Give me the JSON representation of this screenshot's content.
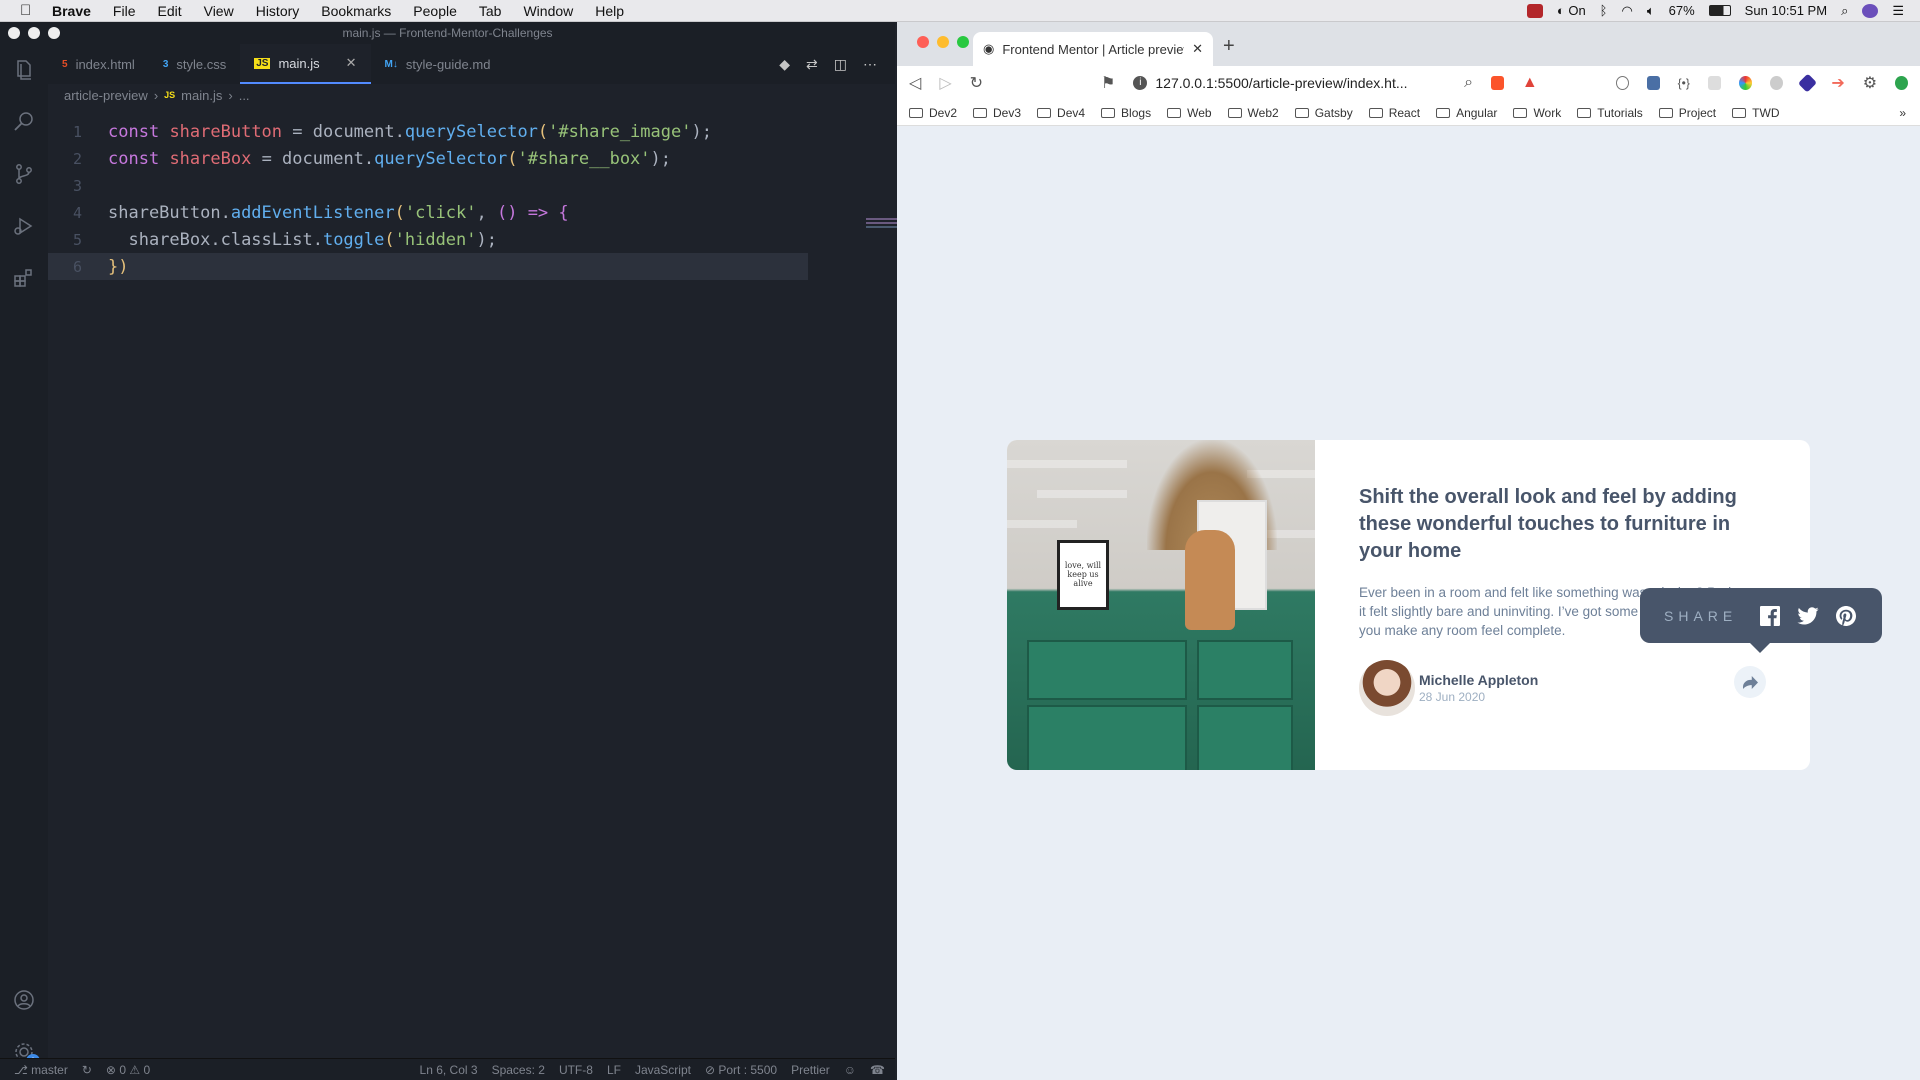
{
  "menubar": {
    "app_name": "Brave",
    "items": [
      "File",
      "Edit",
      "View",
      "History",
      "Bookmarks",
      "People",
      "Tab",
      "Window",
      "Help"
    ],
    "focus_status": "On",
    "battery": "67%",
    "clock": "Sun 10:51 PM"
  },
  "vscode": {
    "window_title": "main.js — Frontend-Mentor-Challenges",
    "tabs": [
      {
        "label": "index.html",
        "icon": "html5-icon",
        "color": "#e44d26"
      },
      {
        "label": "style.css",
        "icon": "css3-icon",
        "color": "#42a5f5"
      },
      {
        "label": "main.js",
        "icon": "js-icon",
        "color": "#f5de19"
      },
      {
        "label": "style-guide.md",
        "icon": "markdown-icon",
        "color": "#42a5f5"
      }
    ],
    "breadcrumb": {
      "folder": "article-preview",
      "file": "main.js",
      "ellipsis": "..."
    },
    "line_numbers": [
      "1",
      "2",
      "3",
      "4",
      "5",
      "6"
    ],
    "code": {
      "l1": {
        "kw": "const",
        "var": "shareButton",
        "eq": " = document.",
        "fn": "querySelector",
        "open": "(",
        "str": "'#share_image'",
        "close": ");"
      },
      "l2": {
        "kw": "const",
        "var": "shareBox",
        "eq": " = document.",
        "fn": "querySelector",
        "open": "(",
        "str": "'#share__box'",
        "close": ");"
      },
      "l4": {
        "obj": "shareButton.",
        "fn": "addEventListener",
        "open": "(",
        "str": "'click'",
        "mid": ", ",
        "arrow": "() => {",
        "close": ""
      },
      "l5": {
        "obj": "shareBox.classList.",
        "fn": "toggle",
        "open": "(",
        "str": "'hidden'",
        "close": ");"
      },
      "l6": {
        "close": "})"
      }
    },
    "status": {
      "branch": "master",
      "problems": "0",
      "warnings": "0",
      "position": "Ln 6, Col 3",
      "spaces": "Spaces: 2",
      "encoding": "UTF-8",
      "eol": "LF",
      "language": "JavaScript",
      "port": "Port : 5500",
      "formatter": "Prettier"
    },
    "settings_badge": "1"
  },
  "browser": {
    "tab_title": "Frontend Mentor | Article preview",
    "url": "127.0.0.1:5500/article-preview/index.ht...",
    "bookmarks": [
      "Dev2",
      "Dev3",
      "Dev4",
      "Blogs",
      "Web",
      "Web2",
      "Gatsby",
      "React",
      "Angular",
      "Work",
      "Tutorials",
      "Project",
      "TWD"
    ],
    "bookmarks_more": "»"
  },
  "article": {
    "image_note": "love, will keep us alive",
    "title": "Shift the overall look and feel by adding these wonderful touches to furniture in your home",
    "description": "Ever been in a room and felt like something was missing? Perhaps it felt slightly bare and uninviting. I’ve got some simple tips to help you make any room feel complete.",
    "author_name": "Michelle Appleton",
    "date": "28 Jun 2020",
    "share_label": "SHARE"
  },
  "colors": {
    "editor_bg": "#1e222a",
    "page_bg": "#e9eef5",
    "card_title": "#48556a",
    "share_popup": "#48556a"
  }
}
